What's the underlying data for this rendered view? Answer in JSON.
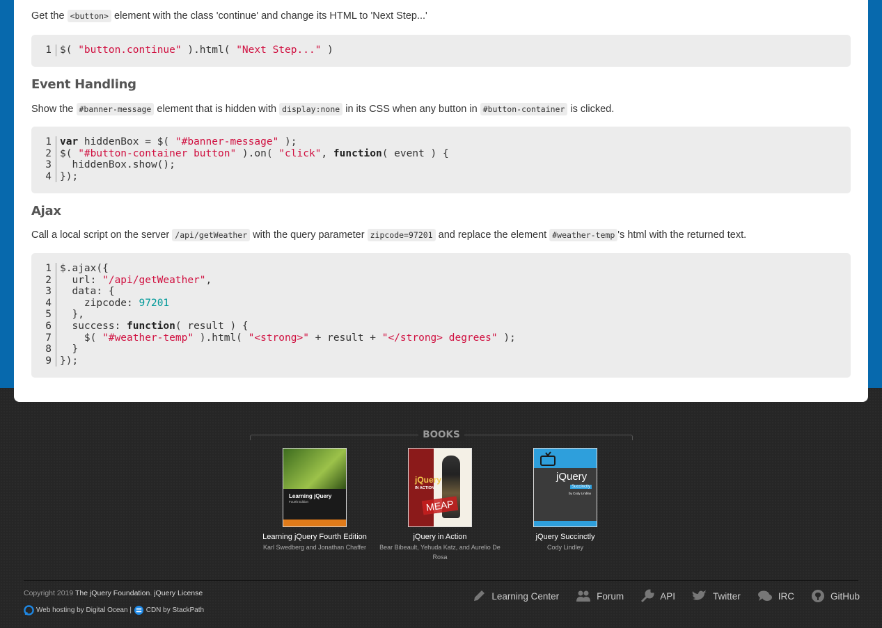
{
  "intro": {
    "pre": "Get the ",
    "code": "<button>",
    "post": " element with the class 'continue' and change its HTML to 'Next Step...'"
  },
  "snippet1": {
    "line_numbers": [
      "1"
    ],
    "parts": [
      "$( ",
      "\"button.continue\"",
      " ).html( ",
      "\"Next Step...\"",
      " )"
    ]
  },
  "event_handling": {
    "heading": "Event Handling",
    "text": [
      "Show the ",
      "#banner-message",
      " element that is hidden with ",
      "display:none",
      " in its CSS when any button in ",
      "#button-container",
      " is clicked."
    ],
    "line_numbers": [
      "1",
      "2",
      "3",
      "4"
    ],
    "code": [
      [
        "var",
        " hiddenBox = $( ",
        "\"#banner-message\"",
        " );"
      ],
      [
        "$( ",
        "\"#button-container button\"",
        " ).on( ",
        "\"click\"",
        ", ",
        "function",
        "( event ) {"
      ],
      [
        "  hiddenBox.show();"
      ],
      [
        "});"
      ]
    ]
  },
  "ajax": {
    "heading": "Ajax",
    "text": [
      "Call a local script on the server ",
      "/api/getWeather",
      " with the query parameter ",
      "zipcode=97201",
      " and replace the element ",
      "#weather-temp",
      "'s html with the returned text."
    ],
    "line_numbers": [
      "1",
      "2",
      "3",
      "4",
      "5",
      "6",
      "7",
      "8",
      "9"
    ],
    "code": [
      [
        "$.ajax({"
      ],
      [
        "  url: ",
        "\"/api/getWeather\"",
        ","
      ],
      [
        "  data: {"
      ],
      [
        "    zipcode: ",
        "97201"
      ],
      [
        "  },"
      ],
      [
        "  success: ",
        "function",
        "( result ) {"
      ],
      [
        "    $( ",
        "\"#weather-temp\"",
        " ).html( ",
        "\"<strong>\"",
        " + result + ",
        "\"</strong> degrees\"",
        " );"
      ],
      [
        "  }"
      ],
      [
        "});"
      ]
    ]
  },
  "books": {
    "heading": "BOOKS",
    "items": [
      {
        "title": "Learning jQuery Fourth Edition",
        "authors": "Karl Swedberg and Jonathan Chaffer",
        "cover_text": "Learning jQuery",
        "cover_sub": "Fourth Edition"
      },
      {
        "title": "jQuery in Action",
        "authors": "Bear Bibeault, Yehuda Katz, and Aurelio De Rosa",
        "cover_text": "jQuery",
        "cover_sub": "IN ACTION",
        "stamp": "MEAP"
      },
      {
        "title": "jQuery Succinctly",
        "authors": "Cody Lindley",
        "cover_text": "jQuery",
        "cover_sub": "Succinctly",
        "cover_by": "by Cody Lindley"
      }
    ]
  },
  "footer": {
    "copyright_prefix": "Copyright 2019 ",
    "foundation": "The jQuery Foundation",
    "separator": ". ",
    "license": "jQuery License",
    "hosting": "Web hosting by Digital Ocean",
    "pipe": " | ",
    "cdn": "CDN by StackPath",
    "nav": [
      {
        "label": "Learning Center",
        "icon": "pencil-icon"
      },
      {
        "label": "Forum",
        "icon": "users-icon"
      },
      {
        "label": "API",
        "icon": "wrench-icon"
      },
      {
        "label": "Twitter",
        "icon": "twitter-icon"
      },
      {
        "label": "IRC",
        "icon": "chat-icon"
      },
      {
        "label": "GitHub",
        "icon": "github-icon"
      }
    ]
  },
  "colors": {
    "brand_blue": "#0769ad",
    "string": "#d01040",
    "number": "#009999",
    "code_bg": "#ececec"
  }
}
